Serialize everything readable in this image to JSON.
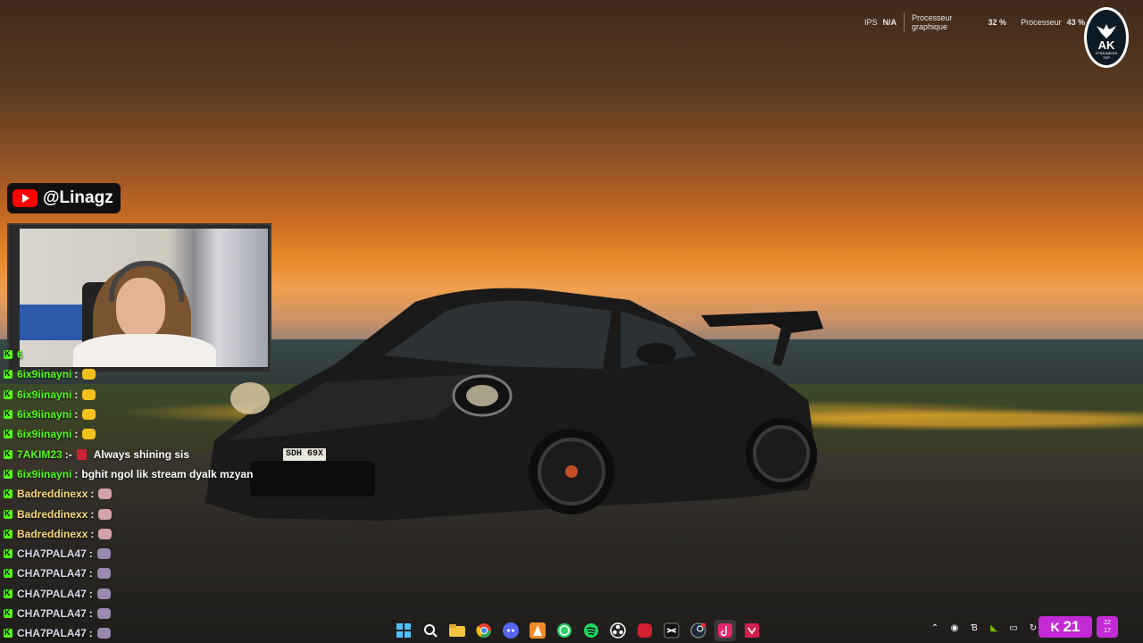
{
  "overlay": {
    "stats": {
      "ips_label": "IPS",
      "ips_value": "N/A",
      "gpu_label_line1": "Processeur",
      "gpu_label_line2": "graphique",
      "gpu_value": "32 %",
      "cpu_label": "Processeur",
      "cpu_value": "43 %",
      "extra_value": "/A"
    },
    "logo": {
      "title": "AK",
      "line1": "STREAMERS",
      "line2": "TOP"
    },
    "channel": {
      "platform_icon": "youtube-icon",
      "handle": "@Linagz"
    },
    "chat": [
      {
        "user": "6",
        "color": "#53fc18",
        "emote": "",
        "text": ""
      },
      {
        "user": "6ix9iinayni",
        "color": "#53fc18",
        "emote": "e1",
        "text": ""
      },
      {
        "user": "6ix9iinayni",
        "color": "#53fc18",
        "emote": "e1",
        "text": ""
      },
      {
        "user": "6ix9iinayni",
        "color": "#53fc18",
        "emote": "e1",
        "text": ""
      },
      {
        "user": "6ix9iinayni",
        "color": "#53fc18",
        "emote": "e1",
        "text": ""
      },
      {
        "user": "7AKIM23",
        "color": "#53fc18",
        "emote": "e4",
        "text": "Always shining sis"
      },
      {
        "user": "6ix9iinayni",
        "color": "#53fc18",
        "emote": "",
        "text": "bghit ngol lik stream dyalk mzyan"
      },
      {
        "user": "Badreddinexx",
        "color": "#f5d77c",
        "emote": "e2",
        "text": ""
      },
      {
        "user": "Badreddinexx",
        "color": "#f5d77c",
        "emote": "e2",
        "text": ""
      },
      {
        "user": "Badreddinexx",
        "color": "#f5d77c",
        "emote": "e2",
        "text": ""
      },
      {
        "user": "CHA7PALA47",
        "color": "#d8d8e8",
        "emote": "e3",
        "text": ""
      },
      {
        "user": "CHA7PALA47",
        "color": "#d8d8e8",
        "emote": "e3",
        "text": ""
      },
      {
        "user": "CHA7PALA47",
        "color": "#d8d8e8",
        "emote": "e3",
        "text": ""
      },
      {
        "user": "CHA7PALA47",
        "color": "#d8d8e8",
        "emote": "e3",
        "text": ""
      },
      {
        "user": "CHA7PALA47",
        "color": "#d8d8e8",
        "emote": "e3",
        "text": ""
      }
    ]
  },
  "wallpaper": {
    "plate": "SDH 69X"
  },
  "taskbar": {
    "icons": [
      "windows-start-icon",
      "search-icon",
      "file-explorer-icon",
      "chrome-icon",
      "discord-icon",
      "vlc-icon",
      "whatsapp-icon",
      "spotify-icon",
      "obs-icon",
      "app-red-icon",
      "capcut-icon",
      "steam-icon",
      "tiktok-icon",
      "app-pink-icon"
    ],
    "kick_count": "21",
    "calendar_day": "22",
    "calendar_sub": "17"
  }
}
